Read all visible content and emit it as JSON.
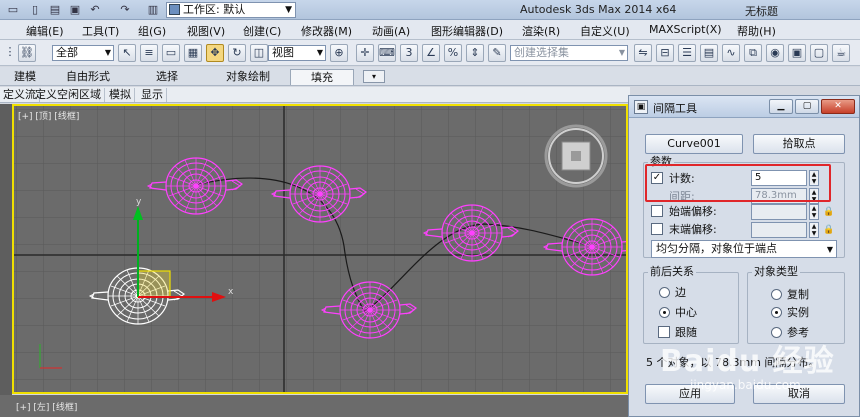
{
  "titlebar": {
    "workspace_label": "工作区: 默认",
    "app_title": "Autodesk 3ds Max  2014 x64",
    "doc_title": "无标题"
  },
  "menu": [
    "编辑(E)",
    "工具(T)",
    "组(G)",
    "视图(V)",
    "创建(C)",
    "修改器(M)",
    "动画(A)",
    "图形编辑器(D)",
    "渲染(R)",
    "自定义(U)",
    "MAXScript(X)",
    "帮助(H)"
  ],
  "toolbar": {
    "selection_filter": "全部",
    "reference_coord": "视图",
    "named_selection_placeholder": "创建选择集"
  },
  "ribbon": {
    "tabs": [
      "建模",
      "自由形式",
      "选择",
      "对象绘制",
      "填充"
    ],
    "active_tab": "填充"
  },
  "submenu": [
    "定义流",
    "定义空闲区域",
    "模拟",
    "显示"
  ],
  "viewport": {
    "label": "[+] [顶] [线框]",
    "bottom_label": "[+] [左] [线框]"
  },
  "dialog": {
    "title": "间隔工具",
    "pick_path_button": "Curve001",
    "pick_points_button": "拾取点",
    "params": {
      "title": "参数",
      "count_label": "计数:",
      "count_value": "5",
      "count_checked": true,
      "spacing_label": "间距:",
      "spacing_value": "78.3mm",
      "start_offset_label": "始端偏移:",
      "start_offset_value": "",
      "end_offset_label": "末端偏移:",
      "end_offset_value": "",
      "distribution": "均匀分隔，对象位于端点"
    },
    "context": {
      "title": "前后关系",
      "options": [
        "边",
        "中心",
        "跟随"
      ],
      "selected": "中心"
    },
    "object_type": {
      "title": "对象类型",
      "options": [
        "复制",
        "实例",
        "参考"
      ],
      "selected": "实例"
    },
    "status_text": "5 个对象，以 78.3mm 间隔分布。",
    "apply_button": "应用",
    "cancel_button": "取消"
  },
  "watermark": {
    "text": "Baidu 经验",
    "url": "jingyan.baidu.com"
  },
  "colors": {
    "viewport_bg": "#6b6b6b",
    "selection_border": "#f0e000",
    "teapot_pink": "#ff40ff",
    "highlight_red": "#e0262a"
  }
}
